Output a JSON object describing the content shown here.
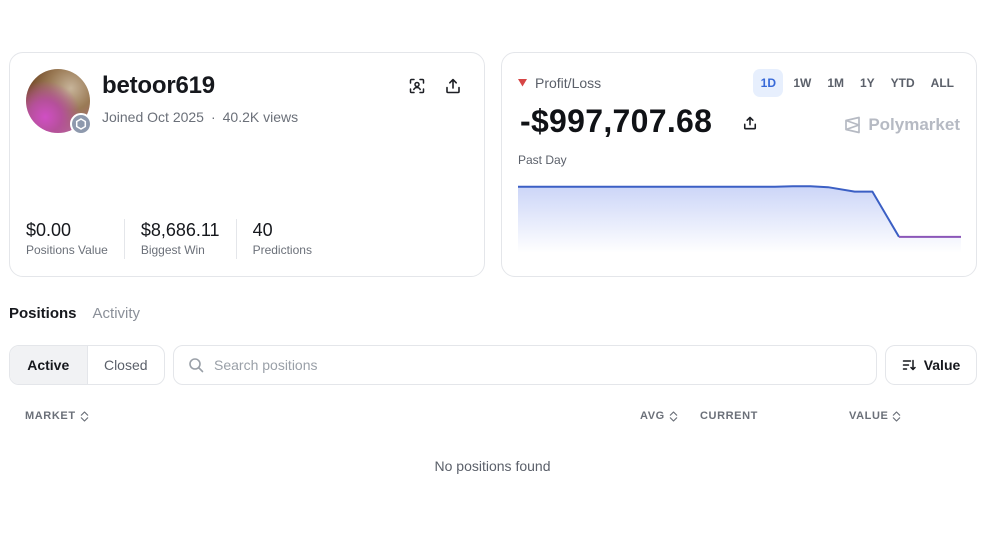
{
  "profile": {
    "username": "betoor619",
    "joined": "Joined Oct 2025",
    "views": "40.2K views",
    "stats": [
      {
        "value": "$0.00",
        "label": "Positions Value"
      },
      {
        "value": "$8,686.11",
        "label": "Biggest Win"
      },
      {
        "value": "40",
        "label": "Predictions"
      }
    ]
  },
  "pnl": {
    "title": "Profit/Loss",
    "value": "-$997,707.68",
    "period": "Past Day",
    "brand": "Polymarket",
    "ranges": [
      "1D",
      "1W",
      "1M",
      "1Y",
      "YTD",
      "ALL"
    ],
    "active_range": "1D",
    "line_color_start": "#3b5fc4",
    "line_color_end": "#8b56b8",
    "chart_data": {
      "type": "area",
      "x": [
        0,
        0.1,
        0.2,
        0.3,
        0.4,
        0.5,
        0.55,
        0.58,
        0.62,
        0.66,
        0.7,
        0.76,
        0.8,
        0.86,
        0.9,
        0.95,
        1.0
      ],
      "y": [
        0.95,
        0.95,
        0.95,
        0.95,
        0.95,
        0.95,
        0.95,
        0.95,
        0.96,
        0.96,
        0.94,
        0.86,
        0.86,
        0.02,
        0.02,
        0.02,
        0.02
      ]
    }
  },
  "tabs": [
    "Positions",
    "Activity"
  ],
  "filters": [
    "Active",
    "Closed"
  ],
  "search": {
    "placeholder": "Search positions"
  },
  "sort": {
    "label": "Value"
  },
  "table": {
    "headers": {
      "market": "MARKET",
      "avg": "AVG",
      "current": "CURRENT",
      "value": "VALUE"
    },
    "empty": "No positions found"
  },
  "colors": {
    "accent": "#3769d8",
    "loss": "#d64545"
  }
}
